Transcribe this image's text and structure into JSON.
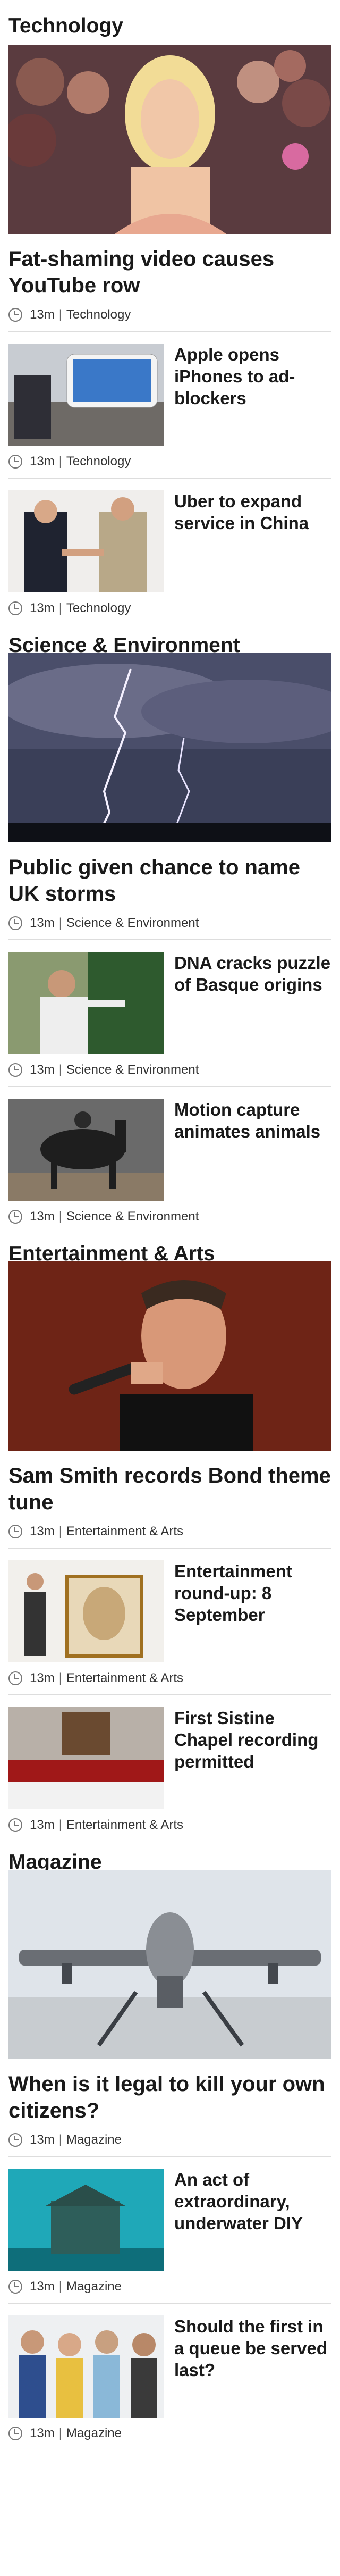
{
  "sections": [
    {
      "title": "Technology",
      "lead": {
        "headline": "Fat-shaming video causes YouTube row",
        "time": "13m",
        "category": "Technology",
        "image": "blonde-celebrity-crowd-photo"
      },
      "stories": [
        {
          "headline": "Apple opens iPhones to ad-blockers",
          "time": "13m",
          "category": "Technology",
          "image": "iphones-photo"
        },
        {
          "headline": "Uber to expand service in China",
          "time": "13m",
          "category": "Technology",
          "image": "handshake-photo"
        }
      ]
    },
    {
      "title": "Science & Environment",
      "lead": {
        "headline": "Public given chance to name UK storms",
        "time": "13m",
        "category": "Science & Environment",
        "image": "lightning-storm-photo"
      },
      "stories": [
        {
          "headline": "DNA cracks puzzle of Basque origins",
          "time": "13m",
          "category": "Science & Environment",
          "image": "basque-dancer-photo"
        },
        {
          "headline": "Motion capture animates animals",
          "time": "13m",
          "category": "Science & Environment",
          "image": "horse-motion-capture-photo"
        }
      ]
    },
    {
      "title": "Entertainment & Arts",
      "lead": {
        "headline": "Sam Smith records Bond theme tune",
        "time": "13m",
        "category": "Entertainment & Arts",
        "image": "singer-microphone-photo"
      },
      "stories": [
        {
          "headline": "Entertainment round-up: 8 September",
          "time": "13m",
          "category": "Entertainment & Arts",
          "image": "queen-portrait-photo"
        },
        {
          "headline": "First Sistine Chapel recording permitted",
          "time": "13m",
          "category": "Entertainment & Arts",
          "image": "choir-photo"
        }
      ]
    },
    {
      "title": "Magazine",
      "lead": {
        "headline": "When is it legal to kill your own citizens?",
        "time": "13m",
        "category": "Magazine",
        "image": "drone-photo"
      },
      "stories": [
        {
          "headline": "An act of extraordinary, underwater DIY",
          "time": "13m",
          "category": "Magazine",
          "image": "underwater-hut-photo"
        },
        {
          "headline": "Should the first in a queue be served last?",
          "time": "13m",
          "category": "Magazine",
          "image": "queue-people-photo"
        }
      ]
    }
  ],
  "separator": "|",
  "colors": {
    "text": "#1a1a1a",
    "meta": "#333333",
    "divider": "#dddddd"
  }
}
